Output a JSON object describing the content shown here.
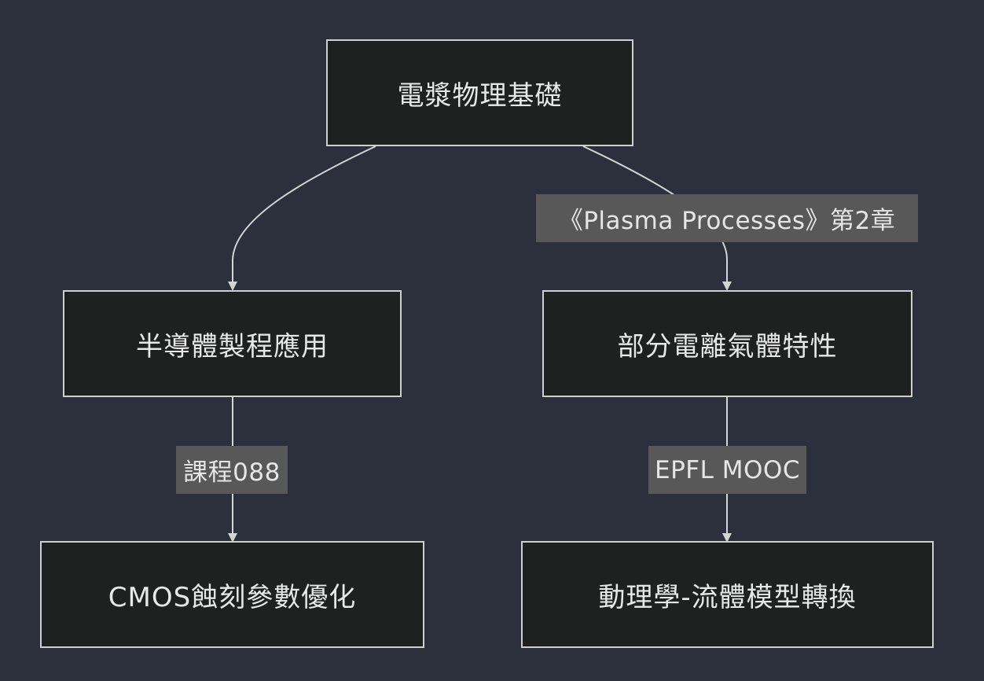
{
  "nodes": {
    "root": "電漿物理基礎",
    "semi": "半導體製程應用",
    "partial": "部分電離氣體特性",
    "cmos": "CMOS蝕刻參數優化",
    "kinetic": "動理學-流體模型轉換"
  },
  "edge_labels": {
    "book": "《Plasma Processes》第2章",
    "course": "課程088",
    "mooc": "EPFL MOOC"
  },
  "colors": {
    "background": "#2b303c",
    "node_fill": "#1f2020",
    "node_border": "#cfcfcf",
    "edge": "#d4d4d4",
    "label_fill": "#585858"
  }
}
